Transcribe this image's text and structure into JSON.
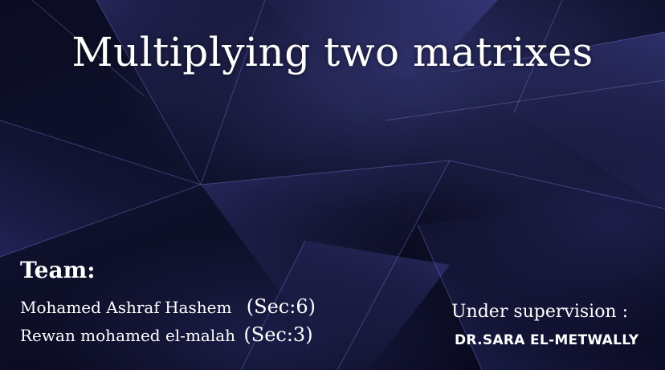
{
  "slide": {
    "title": "Multiplying two matrixes",
    "team_heading": "Team:",
    "members": [
      {
        "name": "Mohamed Ashraf Hashem",
        "section": "(Sec:6)"
      },
      {
        "name": "Rewan mohamed el-malah",
        "section": "(Sec:3)"
      }
    ],
    "supervision_label": "Under supervision :",
    "supervisor": "DR.SARA EL-METWALLY"
  },
  "colors": {
    "background_dark": "#07081a",
    "background_glow": "#464896",
    "text": "#ffffff"
  }
}
